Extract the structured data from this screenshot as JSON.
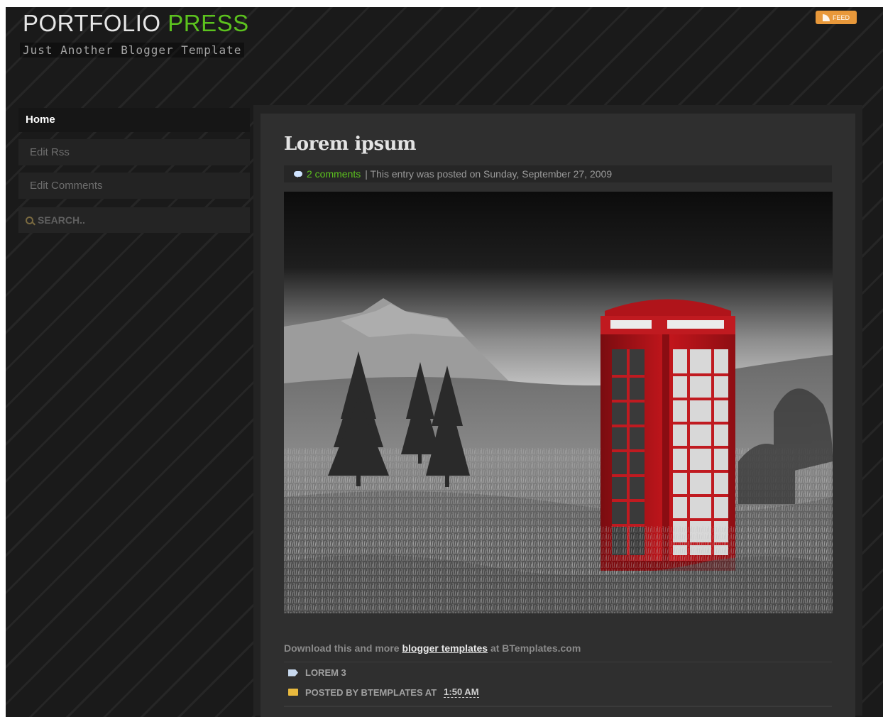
{
  "site": {
    "title_part1": "PORTFOLIO",
    "title_part2": "PRESS",
    "tagline": "Just Another Blogger Template",
    "feed_label": "FEED"
  },
  "sidebar": {
    "items": [
      {
        "label": "Home",
        "active": true
      },
      {
        "label": "Edit Rss"
      },
      {
        "label": "Edit Comments"
      }
    ],
    "search_placeholder": "SEARCH.."
  },
  "post": {
    "title": "Lorem ipsum",
    "comments_link": "2 comments",
    "meta_text": "| This entry was posted on Sunday, September 27, 2009",
    "footer_prefix": "Download this and more",
    "footer_link": "blogger templates",
    "footer_suffix": "at BTemplates.com",
    "label": "LOREM 3",
    "posted_by": "POSTED BY BTEMPLATES AT",
    "posted_time": "1:50 AM"
  },
  "colors": {
    "accent": "#5cc21e",
    "background": "#1b1b1b",
    "panel": "#2f2f2f",
    "booth_red": "#b4141a"
  },
  "icons": {
    "feed": "rss-icon",
    "search": "magnifier-icon",
    "comments": "speech-bubble-icon",
    "label": "tag-icon",
    "posted": "folder-icon"
  }
}
